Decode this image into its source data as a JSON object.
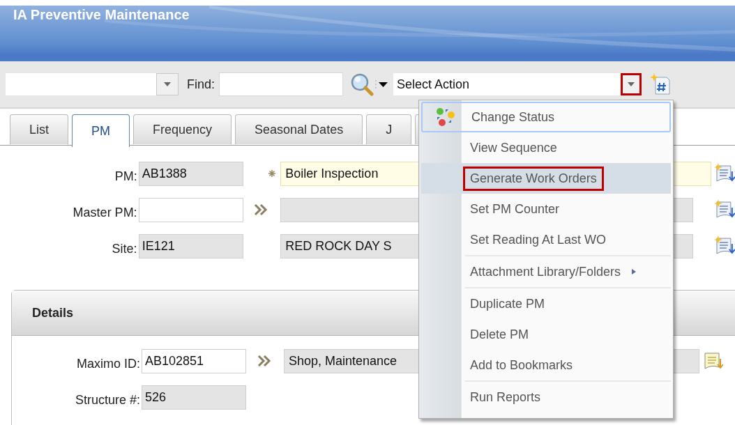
{
  "window": {
    "title": "IA Preventive Maintenance"
  },
  "toolbar": {
    "find_label": "Find:",
    "action_select": {
      "value": "Select Action",
      "annotated": true
    }
  },
  "tabs": [
    {
      "label": "List",
      "selected": false
    },
    {
      "label": "PM",
      "selected": true
    },
    {
      "label": "Frequency",
      "selected": false
    },
    {
      "label": "Seasonal Dates",
      "selected": false
    },
    {
      "label": "J",
      "selected": false
    },
    {
      "selected": false
    }
  ],
  "header_fields": [
    {
      "label": "PM:",
      "value": "AB1388",
      "editable": false,
      "description": "Boiler Inspection",
      "required": true,
      "lookup": false
    },
    {
      "label": "Master PM:",
      "editable": true,
      "required": false,
      "lookup": true
    },
    {
      "label": "Site:",
      "value": "IE121",
      "editable": false,
      "description": "RED ROCK DAY S",
      "required": false,
      "lookup": false
    }
  ],
  "details": {
    "title": "Details",
    "fields": [
      {
        "label": "Maximo ID:",
        "value": "AB102851",
        "editable": true,
        "description": "Shop, Maintenance",
        "required": false,
        "lookup": true
      },
      {
        "label": "Structure #:",
        "value": "526",
        "editable": false
      }
    ]
  },
  "action_menu": [
    {
      "kind": "icon_item",
      "label": "Change Status",
      "focused": true,
      "hovered": false,
      "annotated": false
    },
    {
      "kind": "item",
      "label": "View Sequence",
      "focused": false,
      "hovered": false,
      "annotated": false
    },
    {
      "kind": "item",
      "label": "Generate Work Orders",
      "focused": false,
      "hovered": true,
      "annotated": true
    },
    {
      "kind": "item",
      "label": "Set PM Counter",
      "focused": false,
      "hovered": false,
      "annotated": false
    },
    {
      "kind": "item",
      "label": "Set Reading At Last WO",
      "focused": false,
      "hovered": false,
      "annotated": false
    },
    {
      "kind": "separator"
    },
    {
      "kind": "submenu_item",
      "label": "Attachment Library/Folders",
      "focused": false,
      "hovered": false,
      "annotated": false
    },
    {
      "kind": "separator"
    },
    {
      "kind": "item",
      "label": "Duplicate PM",
      "focused": false,
      "hovered": false,
      "annotated": false
    },
    {
      "kind": "item",
      "label": "Delete PM",
      "focused": false,
      "hovered": false,
      "annotated": false
    },
    {
      "kind": "item",
      "label": "Add to Bookmarks",
      "focused": false,
      "hovered": false,
      "annotated": false
    },
    {
      "kind": "separator"
    },
    {
      "kind": "item",
      "label": "Run Reports",
      "focused": false,
      "hovered": false,
      "annotated": false
    }
  ]
}
